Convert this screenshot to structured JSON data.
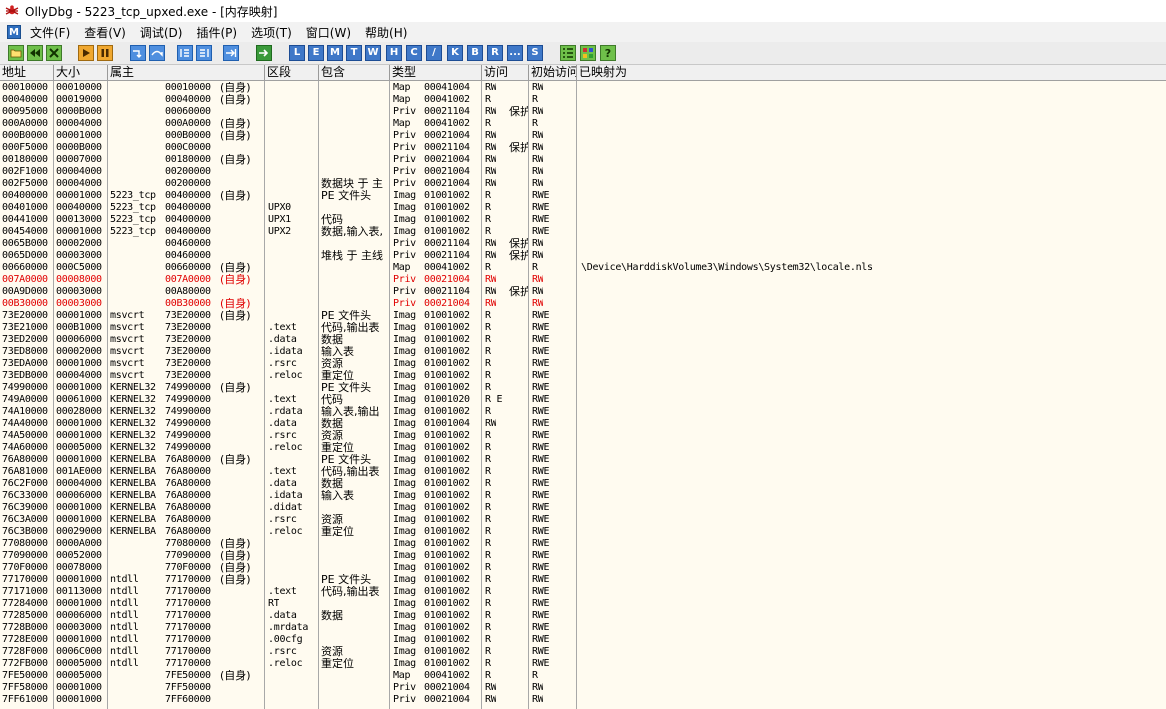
{
  "window": {
    "title": "OllyDbg - 5223_tcp_upxed.exe - [内存映射]"
  },
  "menu": {
    "mdi_icon_label": "M",
    "items": [
      "文件(F)",
      "查看(V)",
      "调试(D)",
      "插件(P)",
      "选项(T)",
      "窗口(W)",
      "帮助(H)"
    ]
  },
  "toolbar": {
    "letters": [
      "L",
      "E",
      "M",
      "T",
      "W",
      "H",
      "C",
      "/",
      "K",
      "B",
      "R",
      "...",
      "S"
    ]
  },
  "columns": [
    "地址",
    "大小",
    "属主",
    "区段",
    "包含",
    "类型",
    "访问",
    "初始访问",
    "已映射为"
  ],
  "rows": [
    [
      "00010000",
      "00010000",
      "",
      "00010000",
      "(自身)",
      "",
      "",
      "Map",
      "00041004",
      "RW",
      "",
      "RW",
      ""
    ],
    [
      "00040000",
      "00019000",
      "",
      "00040000",
      "(自身)",
      "",
      "",
      "Map",
      "00041002",
      "R",
      "",
      "R",
      ""
    ],
    [
      "00095000",
      "0000B000",
      "",
      "00060000",
      "",
      "",
      "",
      "Priv",
      "00021104",
      "RW",
      "保护",
      "RW",
      ""
    ],
    [
      "000A0000",
      "00004000",
      "",
      "000A0000",
      "(自身)",
      "",
      "",
      "Map",
      "00041002",
      "R",
      "",
      "R",
      ""
    ],
    [
      "000B0000",
      "00001000",
      "",
      "000B0000",
      "(自身)",
      "",
      "",
      "Priv",
      "00021004",
      "RW",
      "",
      "RW",
      ""
    ],
    [
      "000F5000",
      "0000B000",
      "",
      "000C0000",
      "",
      "",
      "",
      "Priv",
      "00021104",
      "RW",
      "保护",
      "RW",
      ""
    ],
    [
      "00180000",
      "00007000",
      "",
      "00180000",
      "(自身)",
      "",
      "",
      "Priv",
      "00021004",
      "RW",
      "",
      "RW",
      ""
    ],
    [
      "002F1000",
      "00004000",
      "",
      "00200000",
      "",
      "",
      "",
      "Priv",
      "00021004",
      "RW",
      "",
      "RW",
      ""
    ],
    [
      "002F5000",
      "00004000",
      "",
      "00200000",
      "",
      "",
      "数据块 于 主",
      "Priv",
      "00021004",
      "RW",
      "",
      "RW",
      ""
    ],
    [
      "00400000",
      "00001000",
      "5223_tcp",
      "00400000",
      "(自身)",
      "",
      "PE 文件头",
      "Imag",
      "01001002",
      "R",
      "",
      "RWE",
      ""
    ],
    [
      "00401000",
      "00040000",
      "5223_tcp",
      "00400000",
      "",
      "UPX0",
      "",
      "Imag",
      "01001002",
      "R",
      "",
      "RWE",
      ""
    ],
    [
      "00441000",
      "00013000",
      "5223_tcp",
      "00400000",
      "",
      "UPX1",
      "代码",
      "Imag",
      "01001002",
      "R",
      "",
      "RWE",
      ""
    ],
    [
      "00454000",
      "00001000",
      "5223_tcp",
      "00400000",
      "",
      "UPX2",
      "数据,输入表,",
      "Imag",
      "01001002",
      "R",
      "",
      "RWE",
      ""
    ],
    [
      "0065B000",
      "00002000",
      "",
      "00460000",
      "",
      "",
      "",
      "Priv",
      "00021104",
      "RW",
      "保护",
      "RW",
      ""
    ],
    [
      "0065D000",
      "00003000",
      "",
      "00460000",
      "",
      "",
      "堆栈 于 主线",
      "Priv",
      "00021104",
      "RW",
      "保护",
      "RW",
      ""
    ],
    [
      "00660000",
      "000C5000",
      "",
      "00660000",
      "(自身)",
      "",
      "",
      "Map",
      "00041002",
      "R",
      "",
      "R",
      "\\Device\\HarddiskVolume3\\Windows\\System32\\locale.nls"
    ],
    [
      "007A0000",
      "00008000",
      "",
      "007A0000",
      "(自身)",
      "",
      "",
      "Priv",
      "00021004",
      "RW",
      "",
      "RW",
      ""
    ],
    [
      "00A9D000",
      "00003000",
      "",
      "00A80000",
      "",
      "",
      "",
      "Priv",
      "00021104",
      "RW",
      "保护",
      "RW",
      ""
    ],
    [
      "00B30000",
      "00003000",
      "",
      "00B30000",
      "(自身)",
      "",
      "",
      "Priv",
      "00021004",
      "RW",
      "",
      "RW",
      ""
    ],
    [
      "73E20000",
      "00001000",
      "msvcrt",
      "73E20000",
      "(自身)",
      "",
      "PE 文件头",
      "Imag",
      "01001002",
      "R",
      "",
      "RWE",
      ""
    ],
    [
      "73E21000",
      "000B1000",
      "msvcrt",
      "73E20000",
      "",
      ".text",
      "代码,输出表",
      "Imag",
      "01001002",
      "R",
      "",
      "RWE",
      ""
    ],
    [
      "73ED2000",
      "00006000",
      "msvcrt",
      "73E20000",
      "",
      ".data",
      "数据",
      "Imag",
      "01001002",
      "R",
      "",
      "RWE",
      ""
    ],
    [
      "73ED8000",
      "00002000",
      "msvcrt",
      "73E20000",
      "",
      ".idata",
      "输入表",
      "Imag",
      "01001002",
      "R",
      "",
      "RWE",
      ""
    ],
    [
      "73EDA000",
      "00001000",
      "msvcrt",
      "73E20000",
      "",
      ".rsrc",
      "资源",
      "Imag",
      "01001002",
      "R",
      "",
      "RWE",
      ""
    ],
    [
      "73EDB000",
      "00004000",
      "msvcrt",
      "73E20000",
      "",
      ".reloc",
      "重定位",
      "Imag",
      "01001002",
      "R",
      "",
      "RWE",
      ""
    ],
    [
      "74990000",
      "00001000",
      "KERNEL32",
      "74990000",
      "(自身)",
      "",
      "PE 文件头",
      "Imag",
      "01001002",
      "R",
      "",
      "RWE",
      ""
    ],
    [
      "749A0000",
      "00061000",
      "KERNEL32",
      "74990000",
      "",
      ".text",
      "代码",
      "Imag",
      "01001020",
      "R E",
      "",
      "RWE",
      ""
    ],
    [
      "74A10000",
      "00028000",
      "KERNEL32",
      "74990000",
      "",
      ".rdata",
      "输入表,输出",
      "Imag",
      "01001002",
      "R",
      "",
      "RWE",
      ""
    ],
    [
      "74A40000",
      "00001000",
      "KERNEL32",
      "74990000",
      "",
      ".data",
      "数据",
      "Imag",
      "01001004",
      "RW",
      "",
      "RWE",
      ""
    ],
    [
      "74A50000",
      "00001000",
      "KERNEL32",
      "74990000",
      "",
      ".rsrc",
      "资源",
      "Imag",
      "01001002",
      "R",
      "",
      "RWE",
      ""
    ],
    [
      "74A60000",
      "00005000",
      "KERNEL32",
      "74990000",
      "",
      ".reloc",
      "重定位",
      "Imag",
      "01001002",
      "R",
      "",
      "RWE",
      ""
    ],
    [
      "76A80000",
      "00001000",
      "KERNELBA",
      "76A80000",
      "(自身)",
      "",
      "PE 文件头",
      "Imag",
      "01001002",
      "R",
      "",
      "RWE",
      ""
    ],
    [
      "76A81000",
      "001AE000",
      "KERNELBA",
      "76A80000",
      "",
      ".text",
      "代码,输出表",
      "Imag",
      "01001002",
      "R",
      "",
      "RWE",
      ""
    ],
    [
      "76C2F000",
      "00004000",
      "KERNELBA",
      "76A80000",
      "",
      ".data",
      "数据",
      "Imag",
      "01001002",
      "R",
      "",
      "RWE",
      ""
    ],
    [
      "76C33000",
      "00006000",
      "KERNELBA",
      "76A80000",
      "",
      ".idata",
      "输入表",
      "Imag",
      "01001002",
      "R",
      "",
      "RWE",
      ""
    ],
    [
      "76C39000",
      "00001000",
      "KERNELBA",
      "76A80000",
      "",
      ".didat",
      "",
      "Imag",
      "01001002",
      "R",
      "",
      "RWE",
      ""
    ],
    [
      "76C3A000",
      "00001000",
      "KERNELBA",
      "76A80000",
      "",
      ".rsrc",
      "资源",
      "Imag",
      "01001002",
      "R",
      "",
      "RWE",
      ""
    ],
    [
      "76C3B000",
      "00029000",
      "KERNELBA",
      "76A80000",
      "",
      ".reloc",
      "重定位",
      "Imag",
      "01001002",
      "R",
      "",
      "RWE",
      ""
    ],
    [
      "77080000",
      "0000A000",
      "",
      "77080000",
      "(自身)",
      "",
      "",
      "Imag",
      "01001002",
      "R",
      "",
      "RWE",
      ""
    ],
    [
      "77090000",
      "00052000",
      "",
      "77090000",
      "(自身)",
      "",
      "",
      "Imag",
      "01001002",
      "R",
      "",
      "RWE",
      ""
    ],
    [
      "770F0000",
      "00078000",
      "",
      "770F0000",
      "(自身)",
      "",
      "",
      "Imag",
      "01001002",
      "R",
      "",
      "RWE",
      ""
    ],
    [
      "77170000",
      "00001000",
      "ntdll",
      "77170000",
      "(自身)",
      "",
      "PE 文件头",
      "Imag",
      "01001002",
      "R",
      "",
      "RWE",
      ""
    ],
    [
      "77171000",
      "00113000",
      "ntdll",
      "77170000",
      "",
      ".text",
      "代码,输出表",
      "Imag",
      "01001002",
      "R",
      "",
      "RWE",
      ""
    ],
    [
      "77284000",
      "00001000",
      "ntdll",
      "77170000",
      "",
      "RT",
      "",
      "Imag",
      "01001002",
      "R",
      "",
      "RWE",
      ""
    ],
    [
      "77285000",
      "00006000",
      "ntdll",
      "77170000",
      "",
      ".data",
      "数据",
      "Imag",
      "01001002",
      "R",
      "",
      "RWE",
      ""
    ],
    [
      "7728B000",
      "00003000",
      "ntdll",
      "77170000",
      "",
      ".mrdata",
      "",
      "Imag",
      "01001002",
      "R",
      "",
      "RWE",
      ""
    ],
    [
      "7728E000",
      "00001000",
      "ntdll",
      "77170000",
      "",
      ".00cfg",
      "",
      "Imag",
      "01001002",
      "R",
      "",
      "RWE",
      ""
    ],
    [
      "7728F000",
      "0006C000",
      "ntdll",
      "77170000",
      "",
      ".rsrc",
      "资源",
      "Imag",
      "01001002",
      "R",
      "",
      "RWE",
      ""
    ],
    [
      "772FB000",
      "00005000",
      "ntdll",
      "77170000",
      "",
      ".reloc",
      "重定位",
      "Imag",
      "01001002",
      "R",
      "",
      "RWE",
      ""
    ],
    [
      "7FE50000",
      "00005000",
      "",
      "7FE50000",
      "(自身)",
      "",
      "",
      "Map",
      "00041002",
      "R",
      "",
      "R",
      ""
    ],
    [
      "7FF58000",
      "00001000",
      "",
      "7FF50000",
      "",
      "",
      "",
      "Priv",
      "00021004",
      "RW",
      "",
      "RW",
      ""
    ],
    [
      "7FF61000",
      "00001000",
      "",
      "7FF60000",
      "",
      "",
      "",
      "Priv",
      "00021004",
      "RW",
      "",
      "RW",
      ""
    ]
  ],
  "highlighted_rows": [
    16,
    18
  ],
  "colors": {
    "grid_background": "#fffbf0",
    "highlight_text": "#e00000",
    "header_background": "#f0f0f0"
  }
}
